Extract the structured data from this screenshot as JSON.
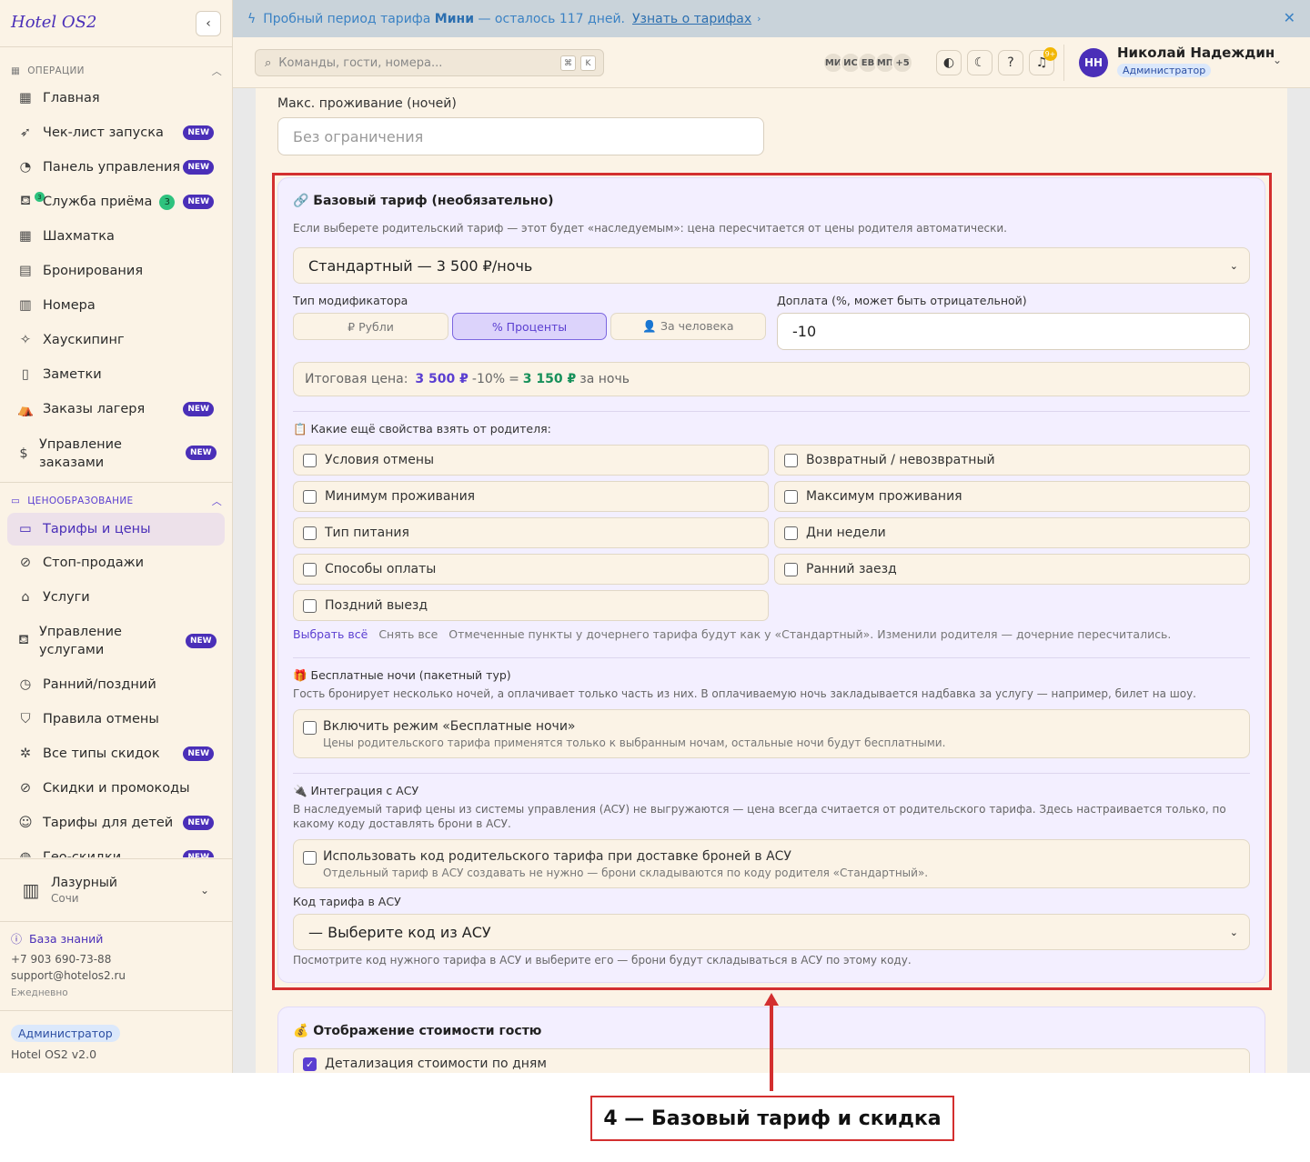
{
  "app": {
    "logo": "Hotel OS2"
  },
  "banner": {
    "text_prefix": "Пробный период тарифа",
    "plan": "Мини",
    "text_suffix": "— осталось 117 дней.",
    "link": "Узнать о тарифах"
  },
  "sidebar": {
    "section_ops": "ОПЕРАЦИИ",
    "section_pricing": "ЦЕНООБРАЗОВАНИЕ",
    "new_badge": "NEW",
    "items": [
      {
        "label": "Главная"
      },
      {
        "label": "Чек-лист запуска"
      },
      {
        "label": "Панель управления"
      },
      {
        "label": "Служба приёма",
        "count": "3"
      },
      {
        "label": "Шахматка"
      },
      {
        "label": "Бронирования"
      },
      {
        "label": "Номера"
      },
      {
        "label": "Хаускипинг"
      },
      {
        "label": "Заметки"
      },
      {
        "label": "Заказы лагеря"
      },
      {
        "label": "Управление заказами"
      }
    ],
    "pricing_items": [
      {
        "label": "Тарифы и цены"
      },
      {
        "label": "Стоп-продажи"
      },
      {
        "label": "Услуги"
      },
      {
        "label": "Управление услугами"
      },
      {
        "label": "Ранний/поздний"
      },
      {
        "label": "Правила отмены"
      },
      {
        "label": "Все типы скидок"
      },
      {
        "label": "Скидки и промокоды"
      },
      {
        "label": "Тарифы для детей"
      },
      {
        "label": "Гео-скидки"
      }
    ],
    "hotel": {
      "name": "Лазурный",
      "city": "Сочи"
    },
    "kb": "База знаний",
    "phone": "+7 903 690-73-88",
    "email": "support@hotelos2.ru",
    "daily": "Ежедневно",
    "role": "Администратор",
    "version": "Hotel OS2 v2.0"
  },
  "header": {
    "search_placeholder": "Команды, гости, номера...",
    "kbd1": "⌘",
    "kbd2": "K",
    "avatars": [
      "МИ",
      "ИС",
      "ЕВ",
      "МП",
      "+5"
    ],
    "notif_count": "9+",
    "user_initials": "НН",
    "user_name": "Николай Надеждин",
    "user_role": "Администратор"
  },
  "form": {
    "max_stay_label": "Макс. проживание (ночей)",
    "max_stay_placeholder": "Без ограничения",
    "base": {
      "title": "🔗 Базовый тариф (необязательно)",
      "desc": "Если выберете родительский тариф — этот будет «наследуемым»: цена пересчитается от цены родителя автоматически.",
      "parent_select": "Стандартный — 3 500 ₽/ночь",
      "mod_type_label": "Тип модификатора",
      "mod_types": [
        "₽ Рубли",
        "% Проценты",
        "👤 За человека"
      ],
      "surcharge_label": "Доплата (%, может быть отрицательной)",
      "surcharge_value": "-10",
      "total_label": "Итоговая цена:",
      "total_base": "3 500 ₽",
      "total_mod": "-10%",
      "total_eq": "=",
      "total_result": "3 150 ₽",
      "total_suffix": "за ночь",
      "inherit_title": "📋 Какие ещё свойства взять от родителя:",
      "inherit": [
        "Условия отмены",
        "Возвратный / невозвратный",
        "Минимум проживания",
        "Максимум проживания",
        "Тип питания",
        "Дни недели",
        "Способы оплаты",
        "Ранний заезд",
        "Поздний выезд"
      ],
      "select_all": "Выбрать всё",
      "clear_all": "Снять все",
      "inherit_note": "Отмеченные пункты у дочернего тарифа будут как у «Стандартный». Изменили родителя — дочерние пересчитались.",
      "free_title": "🎁 Бесплатные ночи (пакетный тур)",
      "free_desc": "Гость бронирует несколько ночей, а оплачивает только часть из них. В оплачиваемую ночь закладывается надбавка за услугу — например, билет на шоу.",
      "free_toggle": "Включить режим «Бесплатные ночи»",
      "free_toggle_desc": "Цены родительского тарифа применятся только к выбранным ночам, остальные ночи будут бесплатными.",
      "asu_title": "🔌 Интеграция с АСУ",
      "asu_desc": "В наследуемый тариф цены из системы управления (АСУ) не выгружаются — цена всегда считается от родительского тарифа. Здесь настраивается только, по какому коду доставлять брони в АСУ.",
      "asu_toggle": "Использовать код родительского тарифа при доставке броней в АСУ",
      "asu_toggle_desc": "Отдельный тариф в АСУ создавать не нужно — брони складываются по коду родителя «Стандартный».",
      "asu_code_label": "Код тарифа в АСУ",
      "asu_code_select": "— Выберите код из АСУ",
      "asu_code_hint": "Посмотрите код нужного тарифа в АСУ и выберите его — брони будут складываться в АСУ по этому коду."
    },
    "display": {
      "title": "💰 Отображение стоимости гостю",
      "daily_breakdown": "Детализация стоимости по дням"
    }
  },
  "annotation": {
    "label": "4 — Базовый тариф и скидка"
  }
}
